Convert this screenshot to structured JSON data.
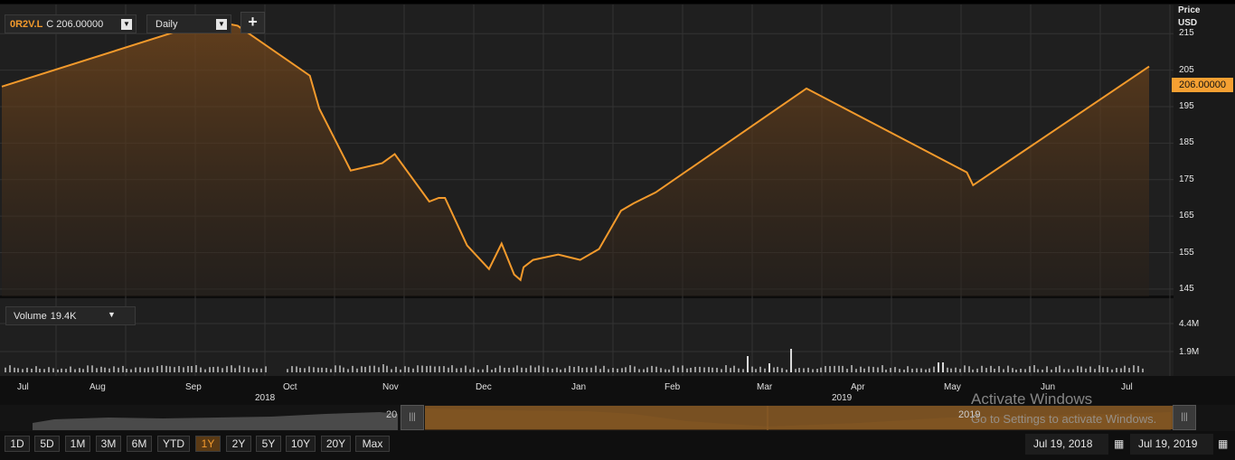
{
  "toolbar": {
    "symbol": "0R2V.L",
    "close_prefix": "C",
    "close_value": "206.00000",
    "interval": "Daily",
    "add_label": "+"
  },
  "axis": {
    "title_line1": "Price",
    "title_line2": "USD",
    "price_ticks": [
      "215",
      "205",
      "195",
      "185",
      "175",
      "165",
      "155",
      "145"
    ],
    "volume_ticks": [
      "4.4M",
      "1.9M"
    ],
    "current_price": "206.00000"
  },
  "volume_selector": {
    "label": "Volume",
    "value": "19.4K"
  },
  "time_axis": {
    "months": [
      "Jul",
      "Aug",
      "Sep",
      "Oct",
      "Nov",
      "Dec",
      "Jan",
      "Feb",
      "Mar",
      "Apr",
      "May",
      "Jun",
      "Jul"
    ],
    "years": [
      "2018",
      "2019"
    ]
  },
  "navigator": {
    "year_left": "20",
    "year_right": "2019",
    "handle_glyph": "|||"
  },
  "range_buttons": [
    "1D",
    "5D",
    "1M",
    "3M",
    "6M",
    "YTD",
    "1Y",
    "2Y",
    "5Y",
    "10Y",
    "20Y",
    "Max"
  ],
  "active_range": "1Y",
  "date_range": {
    "start": "Jul 19, 2018",
    "end": "Jul 19, 2019"
  },
  "watermark": {
    "line1": "Activate Windows",
    "line2": "Go to Settings to activate Windows."
  },
  "colors": {
    "line": "#f39a2c",
    "accent": "#f5a032"
  },
  "chart_data": {
    "type": "area",
    "ylabel": "Price USD",
    "ylim": [
      143,
      223
    ],
    "x": [
      "2018-07-19",
      "2018-09-25",
      "2018-09-27",
      "2018-10-02",
      "2018-10-25",
      "2018-10-28",
      "2018-11-07",
      "2018-11-17",
      "2018-11-21",
      "2018-12-02",
      "2018-12-05",
      "2018-12-07",
      "2018-12-14",
      "2018-12-21",
      "2018-12-25",
      "2018-12-29",
      "2018-12-31",
      "2019-01-01",
      "2019-01-04",
      "2019-01-12",
      "2019-01-19",
      "2019-01-25",
      "2019-02-01",
      "2019-02-05",
      "2019-02-12",
      "2019-04-01",
      "2019-05-22",
      "2019-05-24",
      "2019-07-19"
    ],
    "y": [
      200.5,
      219.0,
      218.0,
      217.2,
      203.5,
      194.5,
      177.5,
      179.5,
      182.0,
      169.0,
      170.0,
      170.0,
      157.0,
      150.5,
      157.5,
      149.0,
      147.5,
      151.0,
      153.0,
      154.5,
      153.0,
      156.0,
      166.5,
      168.5,
      171.5,
      200.0,
      177.0,
      173.5,
      206.0
    ],
    "volume_ticks_m": [
      4.4,
      1.9
    ]
  }
}
